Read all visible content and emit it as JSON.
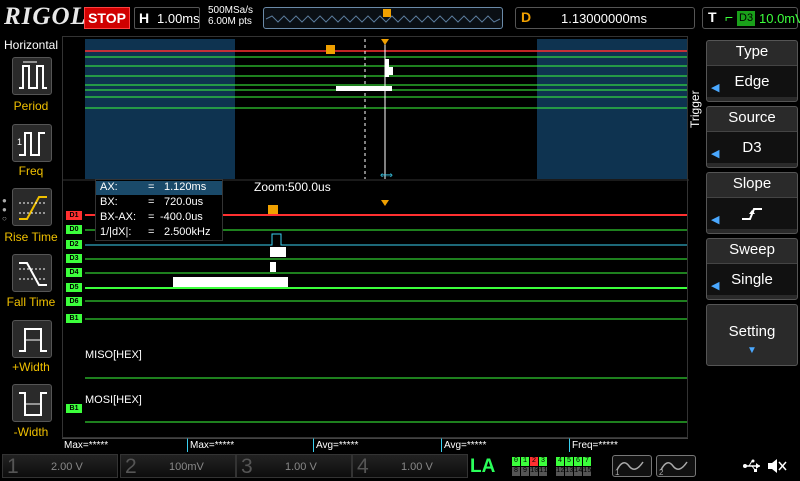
{
  "top": {
    "brand": "RIGOL",
    "run_state": "STOP",
    "h_label": "H",
    "timebase": "1.00ms",
    "sample_rate": "500MSa/s",
    "mem_depth": "6.00M pts",
    "d_label": "D",
    "delay": "1.13000000ms",
    "t_label": "T",
    "trigger_source": "D3",
    "trigger_level": "10.0mV"
  },
  "left": {
    "title": "Horizontal",
    "items": [
      "Period",
      "Freq",
      "Rise Time",
      "Fall Time",
      "+Width",
      "-Width"
    ]
  },
  "right": {
    "side_label": "Trigger",
    "type_title": "Type",
    "type_value": "Edge",
    "source_title": "Source",
    "source_value": "D3",
    "slope_title": "Slope",
    "sweep_title": "Sweep",
    "sweep_value": "Single",
    "setting_label": "Setting"
  },
  "cursor": {
    "ax_label": "AX:",
    "ax_val": "1.120ms",
    "bx_label": "BX:",
    "bx_val": "720.0us",
    "dx_label": "BX-AX:",
    "dx_val": "-400.0us",
    "f_label": "1/|dX|:",
    "f_val": "2.500kHz",
    "eq": "="
  },
  "zoom_label": "Zoom:500.0us",
  "channels_tags": [
    "D1",
    "D0",
    "D2",
    "D3",
    "D4",
    "D5",
    "D6",
    "B1",
    "B1"
  ],
  "bus": {
    "miso": "MISO[HEX]",
    "mosi": "MOSI[HEX]"
  },
  "measure": [
    "Max=*****",
    "Max=*****",
    "Avg=*****",
    "Avg=*****",
    "Freq=*****"
  ],
  "bottom": {
    "ch1_num": "1",
    "ch1_val": "2.00 V",
    "ch2_num": "2",
    "ch2_val": "100mV",
    "ch3_num": "3",
    "ch3_val": "1.00 V",
    "ch4_num": "4",
    "ch4_val": "1.00 V",
    "la": "LA",
    "la_top": [
      "0",
      "1",
      "2",
      "3",
      "",
      "4",
      "5",
      "6",
      "7"
    ],
    "la_bot": [
      "8",
      "9",
      "10",
      "11",
      "",
      "12",
      "13",
      "14",
      "15"
    ],
    "gen1": "1",
    "gen2": "2"
  },
  "colors": {
    "accent_orange": "#f0a000",
    "trace_green": "#3cff3c",
    "trace_red": "#ff3030",
    "trace_white": "#ffffff",
    "panel_blue": "#0e3350",
    "cyan": "#3ad0f0"
  },
  "icons": [
    "period-icon",
    "freq-icon",
    "rise-time-icon",
    "fall-time-icon",
    "pos-width-icon",
    "neg-width-icon",
    "usb-icon",
    "speaker-mute-icon"
  ]
}
